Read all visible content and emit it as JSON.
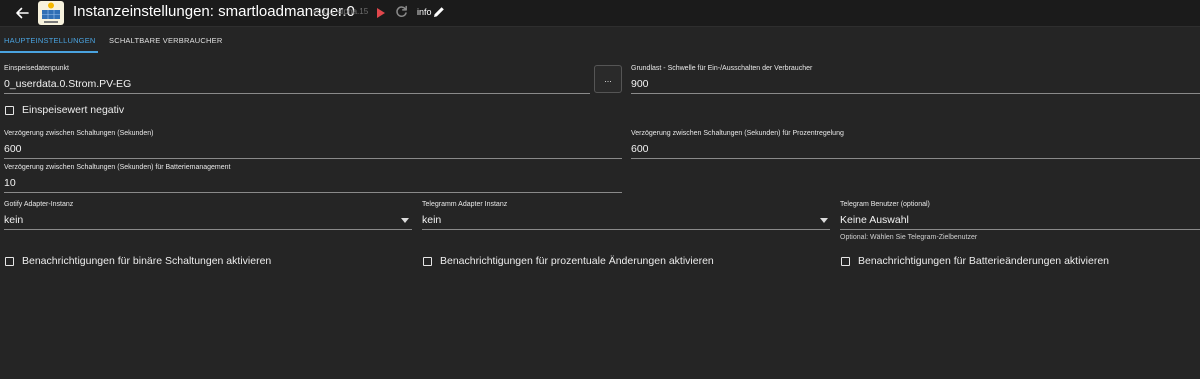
{
  "header": {
    "title": "Instanzeinstellungen: smartloadmanager.0",
    "version": "v0.0.1-alpha.15",
    "info_label": "info"
  },
  "tabs": [
    {
      "label": "HAUPTEINSTELLUNGEN",
      "active": true
    },
    {
      "label": "SCHALTBARE VERBRAUCHER",
      "active": false
    }
  ],
  "fields": {
    "einspeise": {
      "label": "Einspeisedatenpunkt",
      "value": "0_userdata.0.Strom.PV-EG",
      "browse_label": "..."
    },
    "grundlast": {
      "label": "Grundlast - Schwelle für Ein-/Ausschalten der Verbraucher",
      "value": "900"
    },
    "delay": {
      "label": "Verzögerung zwischen Schaltungen (Sekunden)",
      "value": "600"
    },
    "delay_percent": {
      "label": "Verzögerung zwischen Schaltungen (Sekunden) für Prozentregelung",
      "value": "600"
    },
    "delay_battery": {
      "label": "Verzögerung zwischen Schaltungen (Sekunden) für Batteriemanagement",
      "value": "10"
    },
    "gotify": {
      "label": "Gotify Adapter-Instanz",
      "value": "kein"
    },
    "telegram_instance": {
      "label": "Telegramm Adapter Instanz",
      "value": "kein"
    },
    "telegram_user": {
      "label": "Telegram Benutzer (optional)",
      "value": "Keine Auswahl",
      "helper": "Optional: Wählen Sie Telegram-Zielbenutzer"
    }
  },
  "checkboxes": {
    "negative": {
      "label": "Einspeisewert negativ",
      "checked": false
    },
    "binary": {
      "label": "Benachrichtigungen für binäre Schaltungen aktivieren",
      "checked": false
    },
    "percent": {
      "label": "Benachrichtigungen für prozentuale Änderungen aktivieren",
      "checked": false
    },
    "battery": {
      "label": "Benachrichtigungen für Batterieänderungen aktivieren",
      "checked": false
    }
  },
  "colors": {
    "accent": "#4aa3df",
    "play": "#e0474c",
    "background": "#252525"
  }
}
